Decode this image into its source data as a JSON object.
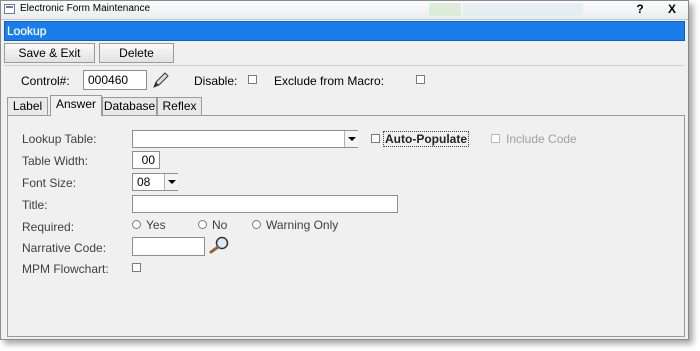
{
  "window": {
    "title": "Electronic Form Maintenance",
    "help": "?",
    "close": "X"
  },
  "banner": {
    "text": "Lookup"
  },
  "toolbar": {
    "save_exit": "Save & Exit",
    "delete": "Delete"
  },
  "header": {
    "control_label": "Control#:",
    "control_value": "000460",
    "disable_label": "Disable:",
    "exclude_label": "Exclude from Macro:"
  },
  "tabs": [
    {
      "label": "Label"
    },
    {
      "label": "Answer"
    },
    {
      "label": "Database"
    },
    {
      "label": "Reflex"
    }
  ],
  "form": {
    "lookup_table_label": "Lookup Table:",
    "lookup_table_value": "",
    "auto_populate_label": "Auto-Populate",
    "include_code_label": "Include Code",
    "table_width_label": "Table Width:",
    "table_width_value": "00",
    "font_size_label": "Font Size:",
    "font_size_value": "08",
    "title_label": "Title:",
    "title_value": "",
    "required_label": "Required:",
    "required_options": [
      "Yes",
      "No",
      "Warning Only"
    ],
    "narrative_label": "Narrative Code:",
    "narrative_value": "",
    "mpm_label": "MPM Flowchart:"
  },
  "icons": {
    "pencil": "pencil-icon",
    "magnifier": "magnifier-icon"
  },
  "colors": {
    "banner": "#1a7ce8",
    "window_bg": "#f0f0f0"
  }
}
